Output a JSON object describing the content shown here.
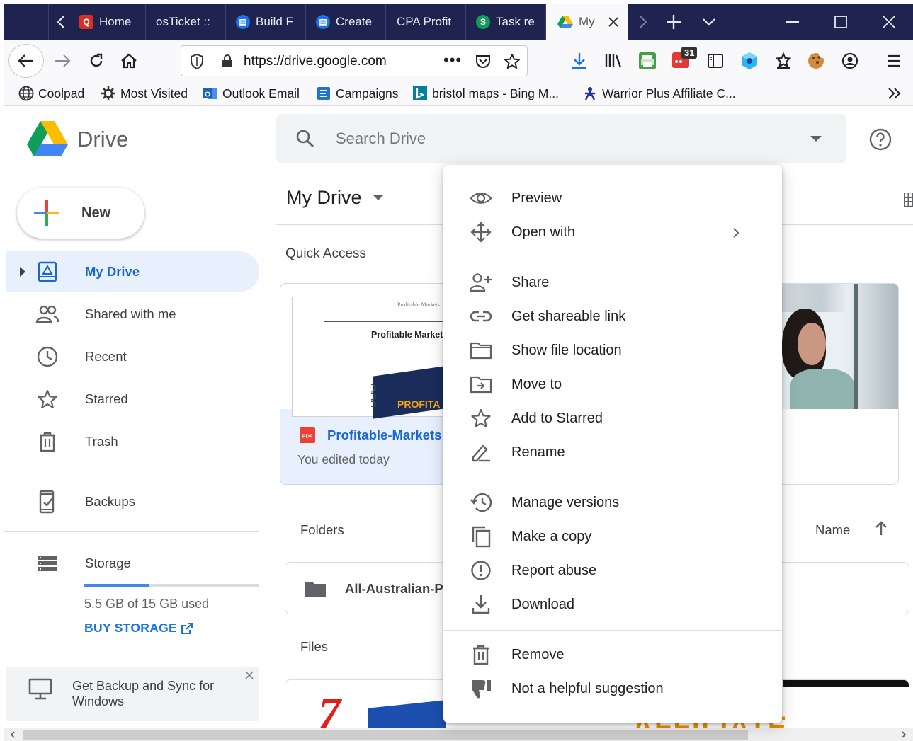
{
  "browser": {
    "tabs": [
      {
        "label": "Home",
        "icon": "q-icon",
        "color": "#d93025"
      },
      {
        "label": "osTicket ::",
        "icon": "none",
        "color": ""
      },
      {
        "label": "Build F",
        "icon": "grid-icon",
        "color": "#1a73e8"
      },
      {
        "label": "Create",
        "icon": "grid-icon",
        "color": "#1a73e8"
      },
      {
        "label": "CPA Profit",
        "icon": "none",
        "color": ""
      },
      {
        "label": "Task re",
        "icon": "s-icon",
        "color": "#0f9d58"
      },
      {
        "label": "My",
        "icon": "drive-icon",
        "color": "#fbbc04"
      }
    ],
    "url": "https://drive.google.com",
    "calendar_badge": "31",
    "bookmarks": [
      {
        "label": "Coolpad",
        "icon": "globe-icon"
      },
      {
        "label": "Most Visited",
        "icon": "gear-icon"
      },
      {
        "label": "Outlook Email",
        "icon": "outlook-icon"
      },
      {
        "label": "Campaigns",
        "icon": "campaigns-icon"
      },
      {
        "label": "bristol maps - Bing M...",
        "icon": "bing-icon"
      },
      {
        "label": "Warrior Plus Affiliate C...",
        "icon": "warrior-icon"
      }
    ]
  },
  "app": {
    "name": "Drive",
    "search_placeholder": "Search Drive"
  },
  "sidebar": {
    "new_label": "New",
    "items": [
      {
        "label": "My Drive",
        "icon": "my-drive-icon"
      },
      {
        "label": "Shared with me",
        "icon": "people-icon"
      },
      {
        "label": "Recent",
        "icon": "clock-icon"
      },
      {
        "label": "Starred",
        "icon": "star-icon"
      },
      {
        "label": "Trash",
        "icon": "trash-icon"
      },
      {
        "label": "Backups",
        "icon": "backup-icon"
      },
      {
        "label": "Storage",
        "icon": "storage-icon"
      }
    ],
    "storage_used": "5.5 GB of 15 GB used",
    "storage_fraction": 0.37,
    "buy_storage": "BUY STORAGE",
    "backup_promo": "Get Backup and Sync for Windows"
  },
  "main": {
    "title": "My Drive",
    "quick_access": "Quick Access",
    "qa_file_name": "Profitable-Markets",
    "qa_file_edited": "You edited today",
    "qa_thumb_title": "Profitable Market",
    "qa_thumb_small": "Profitable Markets",
    "qa_thumb_cover": "PROFITA",
    "folders": "Folders",
    "sort_label": "Name",
    "folder_name": "All-Australian-P",
    "files": "Files",
    "file_thumb_number": "7",
    "file_thumb_text": "AFFILIATE"
  },
  "context_menu": {
    "items": [
      {
        "label": "Preview",
        "icon": "eye-icon"
      },
      {
        "label": "Open with",
        "icon": "move-arrows-icon"
      },
      {
        "label": "Share",
        "icon": "add-person-icon"
      },
      {
        "label": "Get shareable link",
        "icon": "link-icon"
      },
      {
        "label": "Show file location",
        "icon": "folder-outline-icon"
      },
      {
        "label": "Move to",
        "icon": "move-to-icon"
      },
      {
        "label": "Add to Starred",
        "icon": "star-icon"
      },
      {
        "label": "Rename",
        "icon": "pencil-icon"
      },
      {
        "label": "Manage versions",
        "icon": "history-icon"
      },
      {
        "label": "Make a copy",
        "icon": "copy-icon"
      },
      {
        "label": "Report abuse",
        "icon": "alert-icon"
      },
      {
        "label": "Download",
        "icon": "download-icon"
      },
      {
        "label": "Remove",
        "icon": "trash-icon"
      },
      {
        "label": "Not a helpful suggestion",
        "icon": "thumbs-down-icon"
      }
    ]
  }
}
